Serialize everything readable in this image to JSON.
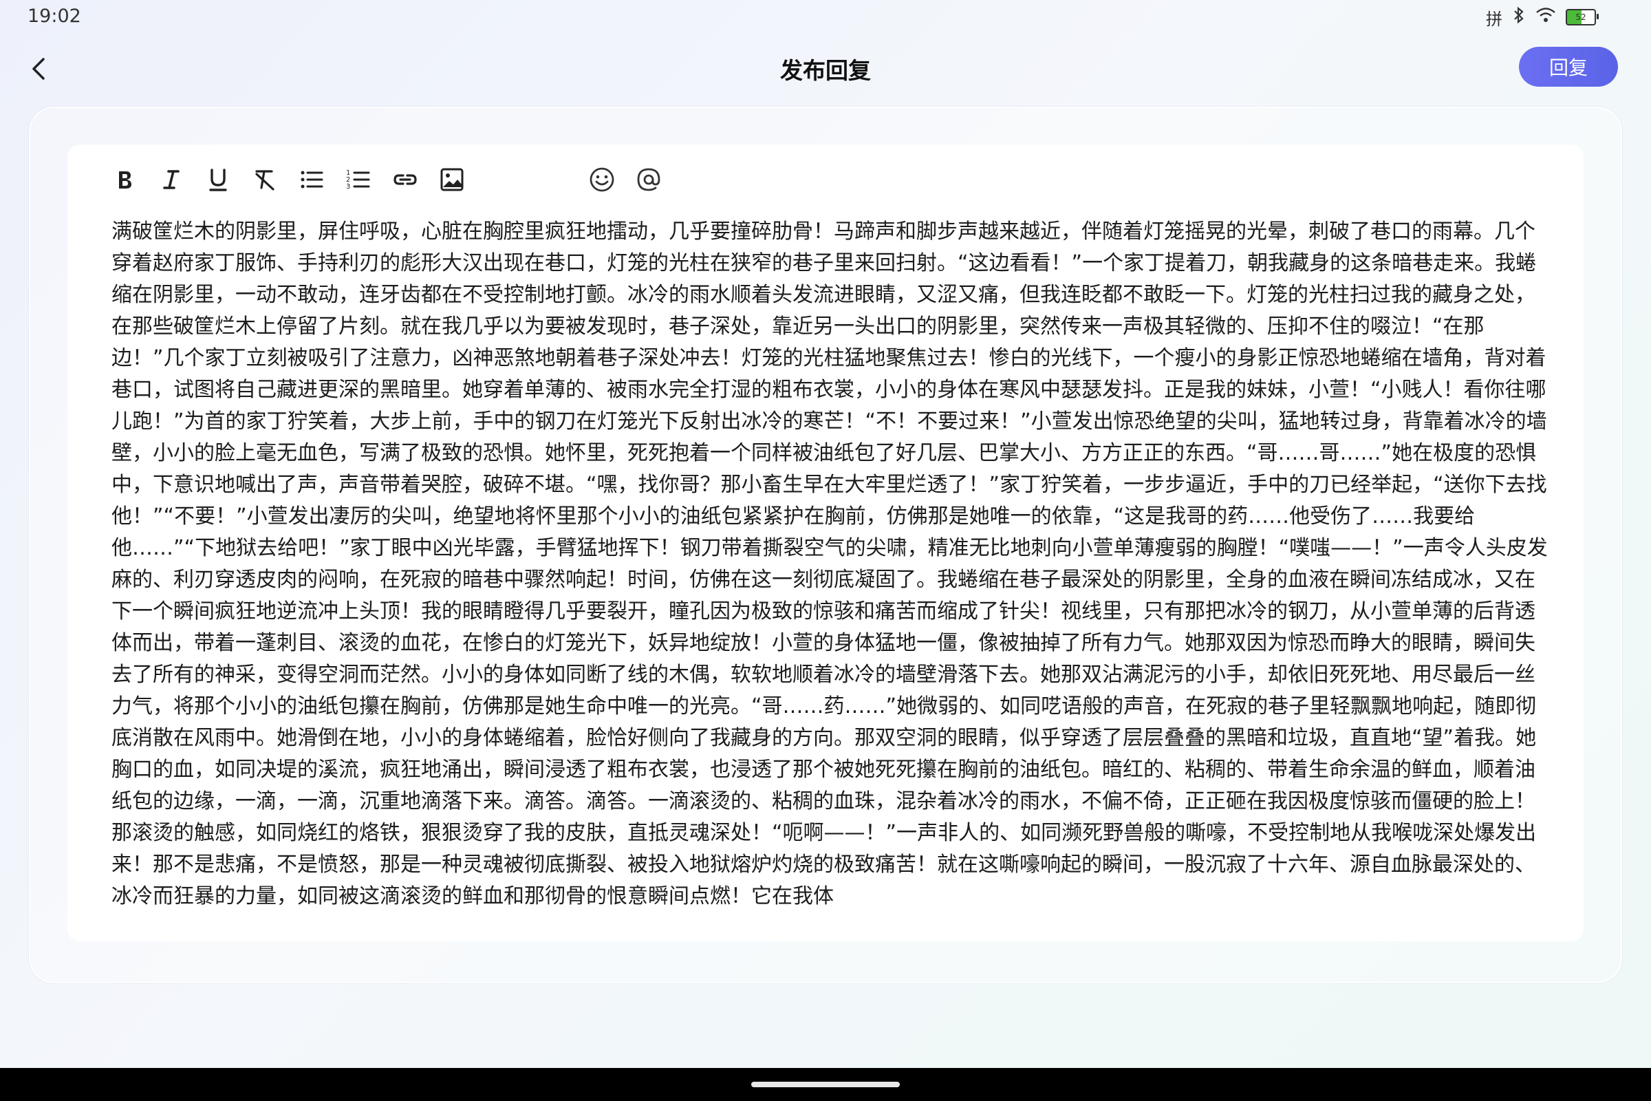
{
  "status": {
    "time": "19:02",
    "ime_label": "拼",
    "battery_level": "52"
  },
  "header": {
    "title": "发布回复",
    "reply_label": "回复"
  },
  "toolbar": {
    "icons": [
      "bold-icon",
      "italic-icon",
      "underline-icon",
      "clear-format-icon",
      "bullet-list-icon",
      "numbered-list-icon",
      "link-icon",
      "image-icon",
      "emoji-icon",
      "mention-icon"
    ]
  },
  "editor": {
    "content": "满破筐烂木的阴影里，屏住呼吸，心脏在胸腔里疯狂地擂动，几乎要撞碎肋骨！马蹄声和脚步声越来越近，伴随着灯笼摇晃的光晕，刺破了巷口的雨幕。几个穿着赵府家丁服饰、手持利刃的彪形大汉出现在巷口，灯笼的光柱在狭窄的巷子里来回扫射。“这边看看！”一个家丁提着刀，朝我藏身的这条暗巷走来。我蜷缩在阴影里，一动不敢动，连牙齿都在不受控制地打颤。冰冷的雨水顺着头发流进眼睛，又涩又痛，但我连眨都不敢眨一下。灯笼的光柱扫过我的藏身之处，在那些破筐烂木上停留了片刻。就在我几乎以为要被发现时，巷子深处，靠近另一头出口的阴影里，突然传来一声极其轻微的、压抑不住的啜泣！“在那边！”几个家丁立刻被吸引了注意力，凶神恶煞地朝着巷子深处冲去！灯笼的光柱猛地聚焦过去！惨白的光线下，一个瘦小的身影正惊恐地蜷缩在墙角，背对着巷口，试图将自己藏进更深的黑暗里。她穿着单薄的、被雨水完全打湿的粗布衣裳，小小的身体在寒风中瑟瑟发抖。正是我的妹妹，小萱！“小贱人！看你往哪儿跑！”为首的家丁狞笑着，大步上前，手中的钢刀在灯笼光下反射出冰冷的寒芒！“不！不要过来！”小萱发出惊恐绝望的尖叫，猛地转过身，背靠着冰冷的墙壁，小小的脸上毫无血色，写满了极致的恐惧。她怀里，死死抱着一个同样被油纸包了好几层、巴掌大小、方方正正的东西。“哥……哥……”她在极度的恐惧中，下意识地喊出了声，声音带着哭腔，破碎不堪。“嘿，找你哥？那小畜生早在大牢里烂透了！”家丁狞笑着，一步步逼近，手中的刀已经举起，“送你下去找他！”“不要！”小萱发出凄厉的尖叫，绝望地将怀里那个小小的油纸包紧紧护在胸前，仿佛那是她唯一的依靠，“这是我哥的药……他受伤了……我要给他……”“下地狱去给吧！”家丁眼中凶光毕露，手臂猛地挥下！钢刀带着撕裂空气的尖啸，精准无比地刺向小萱单薄瘦弱的胸膛！“噗嗤——！”一声令人头皮发麻的、利刃穿透皮肉的闷响，在死寂的暗巷中骤然响起！时间，仿佛在这一刻彻底凝固了。我蜷缩在巷子最深处的阴影里，全身的血液在瞬间冻结成冰，又在下一个瞬间疯狂地逆流冲上头顶！我的眼睛瞪得几乎要裂开，瞳孔因为极致的惊骇和痛苦而缩成了针尖！视线里，只有那把冰冷的钢刀，从小萱单薄的后背透体而出，带着一蓬刺目、滚烫的血花，在惨白的灯笼光下，妖异地绽放！小萱的身体猛地一僵，像被抽掉了所有力气。她那双因为惊恐而睁大的眼睛，瞬间失去了所有的神采，变得空洞而茫然。小小的身体如同断了线的木偶，软软地顺着冰冷的墙壁滑落下去。她那双沾满泥污的小手，却依旧死死地、用尽最后一丝力气，将那个小小的油纸包攥在胸前，仿佛那是她生命中唯一的光亮。“哥……药……”她微弱的、如同呓语般的声音，在死寂的巷子里轻飘飘地响起，随即彻底消散在风雨中。她滑倒在地，小小的身体蜷缩着，脸恰好侧向了我藏身的方向。那双空洞的眼睛，似乎穿透了层层叠叠的黑暗和垃圾，直直地“望”着我。她胸口的血，如同决堤的溪流，疯狂地涌出，瞬间浸透了粗布衣裳，也浸透了那个被她死死攥在胸前的油纸包。暗红的、粘稠的、带着生命余温的鲜血，顺着油纸包的边缘，一滴，一滴，沉重地滴落下来。滴答。滴答。一滴滚烫的、粘稠的血珠，混杂着冰冷的雨水，不偏不倚，正正砸在我因极度惊骇而僵硬的脸上！那滚烫的触感，如同烧红的烙铁，狠狠烫穿了我的皮肤，直抵灵魂深处！“呃啊——！”一声非人的、如同濒死野兽般的嘶嚎，不受控制地从我喉咙深处爆发出来！那不是悲痛，不是愤怒，那是一种灵魂被彻底撕裂、被投入地狱熔炉灼烧的极致痛苦！就在这嘶嚎响起的瞬间，一股沉寂了十六年、源自血脉最深处的、冰冷而狂暴的力量，如同被这滴滚烫的鲜血和那彻骨的恨意瞬间点燃！它在我体"
  },
  "colors": {
    "accent": "#5f66ea",
    "text": "#1d1d1d"
  }
}
